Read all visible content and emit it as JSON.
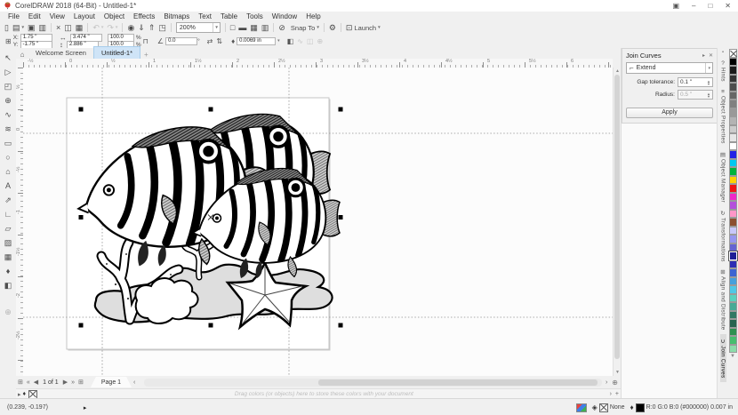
{
  "window": {
    "title": "CorelDRAW 2018 (64-Bit) - Untitled-1*"
  },
  "menubar": {
    "items": [
      "File",
      "Edit",
      "View",
      "Layout",
      "Object",
      "Effects",
      "Bitmaps",
      "Text",
      "Table",
      "Tools",
      "Window",
      "Help"
    ]
  },
  "toolbar": {
    "zoom_level": "200%",
    "snap_label": "Snap To",
    "launch_label": "Launch",
    "items": [
      {
        "t": "b",
        "n": "new-document",
        "g": "▯"
      },
      {
        "t": "d",
        "n": "open",
        "g": "▤"
      },
      {
        "t": "b",
        "n": "save",
        "g": "▣"
      },
      {
        "t": "b",
        "n": "print",
        "g": "▥"
      },
      {
        "t": "s"
      },
      {
        "t": "b",
        "n": "cut",
        "g": "×"
      },
      {
        "t": "b",
        "n": "copy",
        "g": "◫"
      },
      {
        "t": "b",
        "n": "paste",
        "g": "▦"
      },
      {
        "t": "s"
      },
      {
        "t": "d",
        "n": "undo",
        "g": "↶",
        "x": 1
      },
      {
        "t": "d",
        "n": "redo",
        "g": "↷",
        "x": 1
      },
      {
        "t": "s"
      },
      {
        "t": "b",
        "n": "search-content",
        "g": "◉"
      },
      {
        "t": "b",
        "n": "import",
        "g": "⇓"
      },
      {
        "t": "b",
        "n": "export",
        "g": "⇑"
      },
      {
        "t": "b",
        "n": "publish-to-pdf",
        "g": "◳"
      },
      {
        "t": "s"
      },
      {
        "t": "z"
      },
      {
        "t": "s"
      },
      {
        "t": "b",
        "n": "full-screen-preview",
        "g": "□"
      },
      {
        "t": "b",
        "n": "show-rulers",
        "g": "▬"
      },
      {
        "t": "b",
        "n": "show-grid",
        "g": "▦"
      },
      {
        "t": "b",
        "n": "show-guidelines",
        "g": "▥"
      },
      {
        "t": "s"
      },
      {
        "t": "b",
        "n": "snap-off",
        "g": "⊘"
      },
      {
        "t": "t",
        "n": "snap-to",
        "key": "snap_label"
      },
      {
        "t": "s"
      },
      {
        "t": "b",
        "n": "options",
        "g": "⚙"
      },
      {
        "t": "s"
      },
      {
        "t": "tb",
        "n": "launch",
        "g": "⊡",
        "key": "launch_label"
      }
    ]
  },
  "propbar": {
    "x_label": "X:",
    "x": "1.75 \"",
    "y_label": "Y:",
    "y": "-1.75 \"",
    "width": "3.474 \"",
    "height": "2.886 \"",
    "scale_x": "100.0",
    "scale_y": "100.0",
    "percent": "%",
    "angle": "0.0",
    "outline_width": "0.0069 in"
  },
  "tabs": {
    "welcome": "Welcome Screen",
    "doc": "Untitled-1*"
  },
  "toolbox": {
    "tools": [
      {
        "n": "pick-tool",
        "g": "↖"
      },
      {
        "n": "shape-tool",
        "g": "▷"
      },
      {
        "n": "crop-tool",
        "g": "◰"
      },
      {
        "n": "zoom-tool",
        "g": "⊕"
      },
      {
        "n": "freehand-tool",
        "g": "∿"
      },
      {
        "n": "artistic-media-tool",
        "g": "≋"
      },
      {
        "n": "rectangle-tool",
        "g": "▭"
      },
      {
        "n": "ellipse-tool",
        "g": "○"
      },
      {
        "n": "polygon-tool",
        "g": "⌂"
      },
      {
        "n": "text-tool",
        "g": "A"
      },
      {
        "n": "dimension-tool",
        "g": "⇗"
      },
      {
        "n": "connector-tool",
        "g": "∟"
      },
      {
        "n": "drop-shadow-tool",
        "g": "▱"
      },
      {
        "n": "transparency-tool",
        "g": "▨"
      },
      {
        "n": "mesh-fill-tool",
        "g": "▦"
      },
      {
        "n": "color-eyedropper-tool",
        "g": "♦"
      },
      {
        "n": "interactive-fill-tool",
        "g": "◧"
      }
    ],
    "customize_glyph": "⊕"
  },
  "ruler": {
    "h_labels": [
      "-½",
      "0",
      "½",
      "1",
      "1½",
      "2",
      "2½",
      "3",
      "3½",
      "4",
      "4½",
      "5",
      "5½",
      "6"
    ],
    "v_labels": [
      "½",
      "0",
      "-½",
      "-1",
      "-1½",
      "-2",
      "-2½"
    ]
  },
  "docker": {
    "title": "Join Curves",
    "preset": "Extend",
    "gap_label": "Gap tolerance:",
    "gap_value": "0.1 \"",
    "radius_label": "Radius:",
    "radius_value": "0.5 \"",
    "apply": "Apply"
  },
  "right_tabs": {
    "items": [
      {
        "icon": "?",
        "label": "Hints"
      },
      {
        "icon": "≡",
        "label": "Object Properties"
      },
      {
        "icon": "▤",
        "label": "Object Manager"
      },
      {
        "icon": "↻",
        "label": "Transformations"
      },
      {
        "icon": "⊞",
        "label": "Align and Distribute"
      },
      {
        "icon": "∪",
        "label": "Join Curves",
        "active": true
      }
    ]
  },
  "palette": {
    "selected_index": 24,
    "swatches": [
      "none",
      "#000000",
      "#1a1a1a",
      "#333333",
      "#4d4d4d",
      "#666666",
      "#808080",
      "#999999",
      "#b3b3b3",
      "#cccccc",
      "#e6e6e6",
      "#ffffff",
      "#2222e6",
      "#00c8f0",
      "#00b43c",
      "#ffd200",
      "#f01414",
      "#f028c8",
      "#b450dc",
      "#ff96c8",
      "#8c5030",
      "#c8c8fa",
      "#9696f0",
      "#6464d2",
      "#1e1e96",
      "#2d2db4",
      "#3c64d2",
      "#46a0dc",
      "#50c8e6",
      "#5ad2be",
      "#46aa96",
      "#327864",
      "#286450",
      "#2d9150",
      "#46be6e",
      "#8cdcaa"
    ]
  },
  "pagenav": {
    "label": "1 of 1",
    "page_tab": "Page 1"
  },
  "docpalette": {
    "hint": "Drag colors (or objects) here to store these colors with your document"
  },
  "statusbar": {
    "coords": "(0.239, -0.197)",
    "fill_label": "None",
    "outline_rgb": "R:0 G:0 B:0 (#000000)",
    "outline_width": "0.007 in"
  }
}
